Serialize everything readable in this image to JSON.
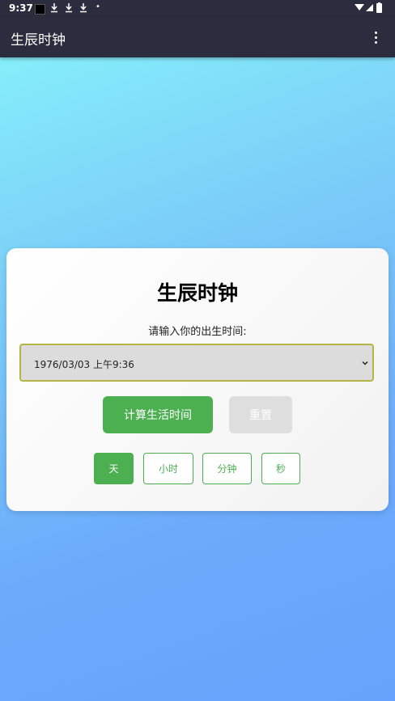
{
  "status_bar": {
    "time": "9:37",
    "dot": "•"
  },
  "app_bar": {
    "title": "生辰时钟",
    "menu_icon": "more-vertical-icon"
  },
  "card": {
    "title": "生辰时钟",
    "prompt": "请输入你的出生时间:",
    "date_value": "1976/03/03 上午9:36",
    "calc_label": "计算生活时间",
    "reset_label": "重置",
    "units": [
      {
        "label": "天",
        "active": true
      },
      {
        "label": "小时",
        "active": false
      },
      {
        "label": "分钟",
        "active": false
      },
      {
        "label": "秒",
        "active": false
      }
    ]
  },
  "colors": {
    "accent": "#4caf50",
    "app_bar": "#2c2c3f",
    "select_border": "#b5b545"
  }
}
